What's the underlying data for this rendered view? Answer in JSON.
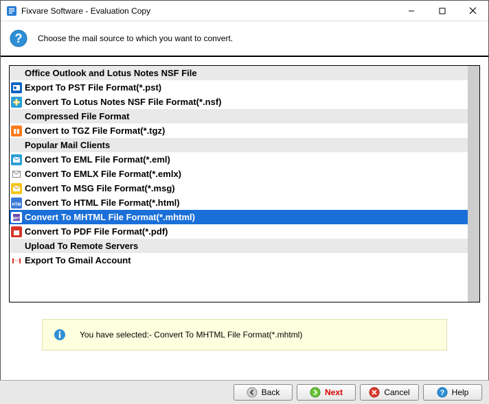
{
  "window": {
    "title": "Fixvare Software - Evaluation Copy"
  },
  "header": {
    "prompt": "Choose the mail source to which you want to convert."
  },
  "list": {
    "items": [
      {
        "type": "category",
        "label": "Office Outlook and Lotus Notes NSF File"
      },
      {
        "type": "option",
        "label": "Export To PST File Format(*.pst)",
        "icon": "outlook"
      },
      {
        "type": "option",
        "label": "Convert To Lotus Notes NSF File Format(*.nsf)",
        "icon": "nsf"
      },
      {
        "type": "category",
        "label": "Compressed File Format"
      },
      {
        "type": "option",
        "label": "Convert to TGZ File Format(*.tgz)",
        "icon": "tgz"
      },
      {
        "type": "category",
        "label": "Popular Mail Clients"
      },
      {
        "type": "option",
        "label": "Convert To EML File Format(*.eml)",
        "icon": "eml"
      },
      {
        "type": "option",
        "label": "Convert To EMLX File Format(*.emlx)",
        "icon": "emlx"
      },
      {
        "type": "option",
        "label": "Convert To MSG File Format(*.msg)",
        "icon": "msg"
      },
      {
        "type": "option",
        "label": "Convert To HTML File Format(*.html)",
        "icon": "html"
      },
      {
        "type": "option",
        "label": "Convert To MHTML File Format(*.mhtml)",
        "icon": "mhtml",
        "selected": true
      },
      {
        "type": "option",
        "label": "Convert To PDF File Format(*.pdf)",
        "icon": "pdf"
      },
      {
        "type": "category",
        "label": "Upload To Remote Servers"
      },
      {
        "type": "option",
        "label": "Export To Gmail Account",
        "icon": "gmail"
      }
    ]
  },
  "info": {
    "text": "You have selected:- Convert To MHTML File Format(*.mhtml)"
  },
  "footer": {
    "back": "Back",
    "next": "Next",
    "cancel": "Cancel",
    "help": "Help"
  }
}
